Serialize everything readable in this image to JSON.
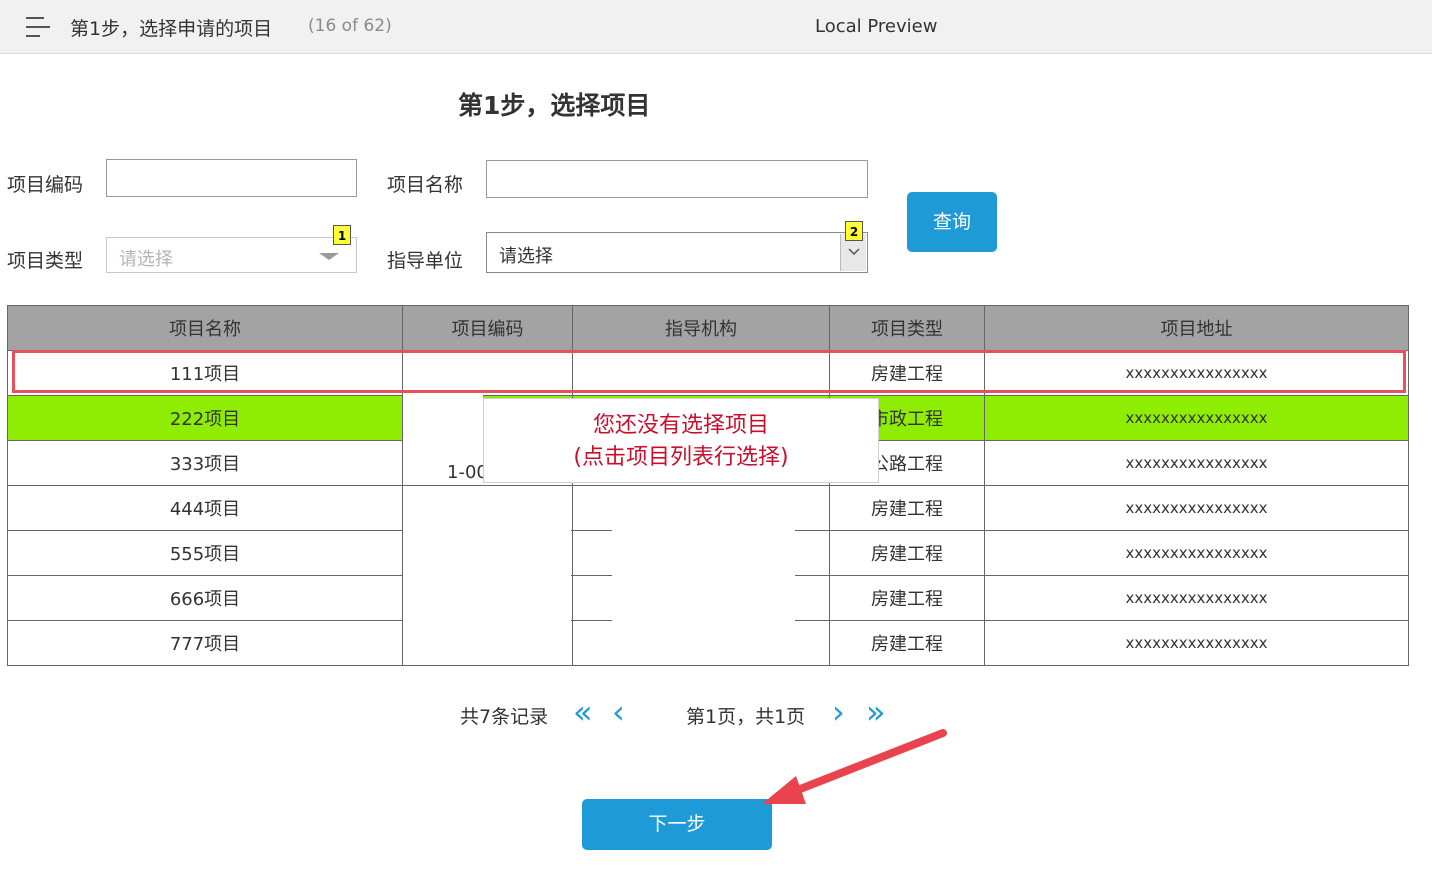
{
  "topbar": {
    "title": "第1步，选择申请的项目",
    "counter": "(16 of 62)",
    "preview_label": "Local Preview"
  },
  "page_title": "第1步，选择项目",
  "form": {
    "code_label": "项目编码",
    "code_value": "",
    "name_label": "项目名称",
    "name_value": "",
    "type_label": "项目类型",
    "type_placeholder": "请选择",
    "type_badge": "1",
    "org_label": "指导单位",
    "org_value": "请选择",
    "org_badge": "2",
    "query_label": "查询"
  },
  "table": {
    "columns": [
      "项目名称",
      "项目编码",
      "指导机构",
      "项目类型",
      "项目地址"
    ],
    "rows": [
      {
        "name": "111项目",
        "type": "房建工程",
        "addr": "xxxxxxxxxxxxxxxx"
      },
      {
        "name": "222项目",
        "type": "市政工程",
        "addr": "xxxxxxxxxxxxxxxx"
      },
      {
        "name": "333项目",
        "type": "公路工程",
        "addr": "xxxxxxxxxxxxxxxx"
      },
      {
        "name": "444项目",
        "type": "房建工程",
        "addr": "xxxxxxxxxxxxxxxx"
      },
      {
        "name": "555项目",
        "type": "房建工程",
        "addr": "xxxxxxxxxxxxxxxx"
      },
      {
        "name": "666项目",
        "type": "房建工程",
        "addr": "xxxxxxxxxxxxxxxx"
      },
      {
        "name": "777项目",
        "type": "房建工程",
        "addr": "xxxxxxxxxxxxxxxx"
      }
    ],
    "code_fragment": "1-00"
  },
  "tooltip": {
    "line1": "您还没有选择项目",
    "line2": "(点击项目列表行选择)"
  },
  "pager": {
    "total": "共7条记录",
    "info": "第1页，共1页",
    "first": "«",
    "prev": "‹",
    "next": "›",
    "last": "»"
  },
  "next_button": "下一步",
  "colors": {
    "accent": "#1e9ad6",
    "highlight_row": "#8eed02",
    "selection_border": "#e8505b",
    "tip_text": "#c8102e"
  }
}
